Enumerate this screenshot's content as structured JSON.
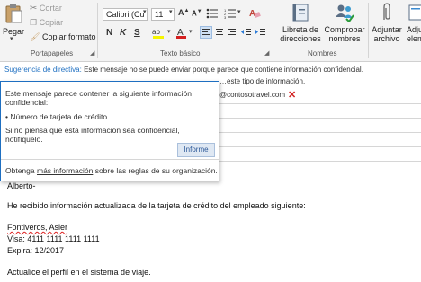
{
  "ribbon": {
    "clipboard": {
      "paste_label": "Pegar",
      "cut_label": "Cortar",
      "copy_label": "Copiar",
      "format_label": "Copiar formato",
      "group_label": "Portapapeles"
    },
    "basic_text": {
      "font_name": "Calibri (Cu",
      "font_size": "11",
      "bold": "N",
      "italic": "K",
      "underline": "S",
      "group_label": "Texto básico"
    },
    "names": {
      "address_book_label": "Libreta de direcciones",
      "check_names_label": "Comprobar nombres",
      "group_label": "Nombres"
    },
    "include": {
      "attach_file_label": "Adjuntar archivo",
      "attach_item_label": "Adjuntar elem"
    }
  },
  "policy_bar": {
    "prefix": "Sugerencia de directiva:",
    "message": "Este mensaje no se puede enviar porque parece que contiene información confidencial."
  },
  "recipients": {
    "to_partial": "…rd@contosotravel.com",
    "cc_partial": "…este tipo de información.",
    "bcc_partial": "@contosotravel.com"
  },
  "popup": {
    "line1": "Este mensaje parece contener la siguiente información",
    "line2": "confidencial:",
    "bullet": "• Número de tarjeta de crédito",
    "line3": "Si no piensa que esta información sea confidencial,",
    "line4": "notifíquelo.",
    "report_button": "Informe",
    "footer_before": "Obtenga ",
    "footer_link": "más información",
    "footer_after": " sobre las reglas de su organización."
  },
  "email": {
    "greeting": "Alberto-",
    "intro": "He recibido información actualizada de la tarjeta de crédito del empleado siguiente:",
    "employee_name": "Fontiveros, Asier",
    "visa": "Visa: 4111 1111 1111 1111",
    "expiry": "Expira: 12/2017",
    "closing": "Actualice el perfil en el sistema de viaje."
  },
  "colors": {
    "accent": "#1e6fc1",
    "error": "#d22222",
    "highlight": "#f5f500",
    "font_red": "#d42020"
  }
}
